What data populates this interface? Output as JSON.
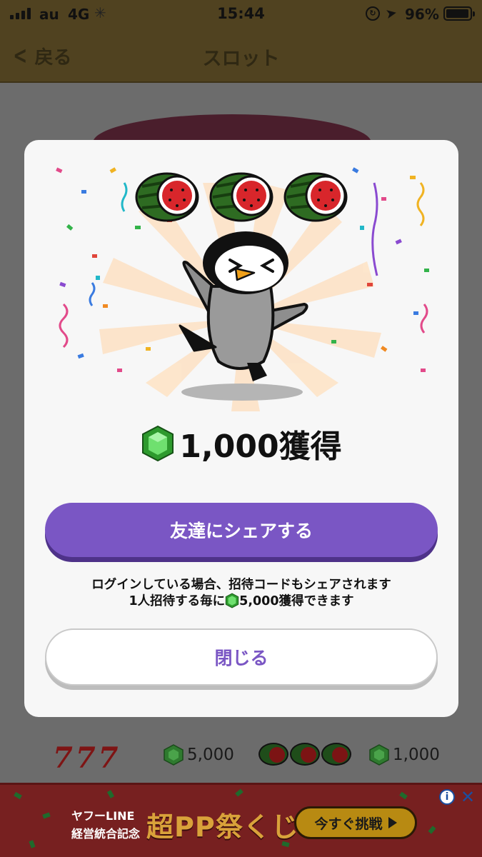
{
  "status_bar": {
    "carrier": "au",
    "network": "4G",
    "time": "15:44",
    "battery": "96%",
    "battery_level": 0.96
  },
  "nav": {
    "back_label": "戻る",
    "title": "スロット"
  },
  "modal": {
    "reel_symbols": [
      "watermelon",
      "watermelon",
      "watermelon"
    ],
    "mascot": "penguin",
    "prize_icon": "green-gem-icon",
    "prize_amount": "1,000獲得",
    "share_button": "友達にシェアする",
    "note_line1": "ログインしている場合、招待コードもシェアされます",
    "note_line2_prefix": "1人招待する毎に",
    "note_line2_suffix": "5,000獲得できます",
    "close_button": "閉じる"
  },
  "payout_table": {
    "rows": [
      {
        "symbol": "777",
        "reward": "5,000"
      },
      {
        "symbol": "watermelon x3",
        "reward": "1,000"
      }
    ]
  },
  "ad": {
    "line1": "ヤフーLINE",
    "line2": "経営統合記念",
    "headline": "超PP祭くじ",
    "cta": "今すぐ挑戦"
  },
  "colors": {
    "accent_purple": "#7a56c4",
    "header_brown": "#504220",
    "gem_green": "#4cc94c"
  }
}
